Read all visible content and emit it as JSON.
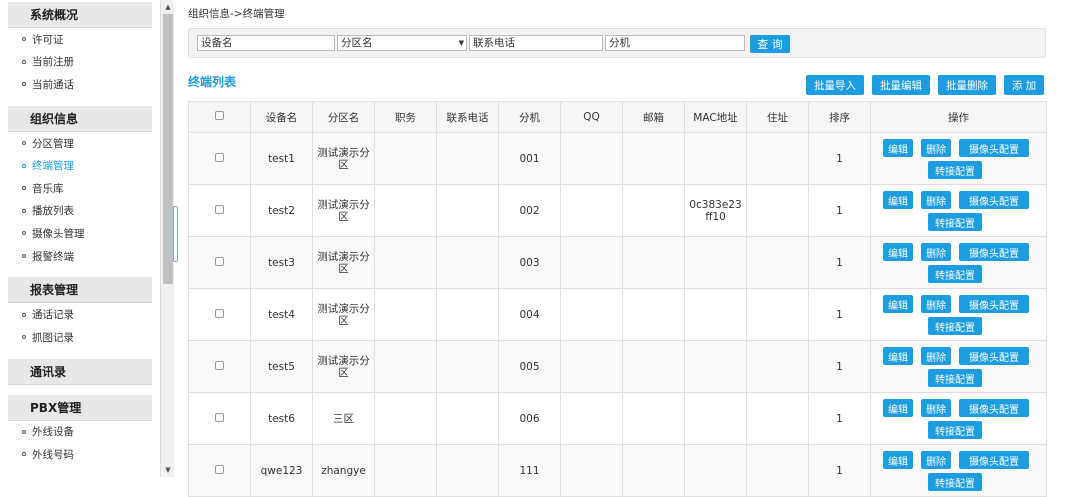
{
  "sidebar": {
    "sections": [
      {
        "title": "系统概况",
        "items": [
          "许可证",
          "当前注册",
          "当前通话"
        ]
      },
      {
        "title": "组织信息",
        "items": [
          "分区管理",
          "终端管理",
          "音乐库",
          "播放列表",
          "摄像头管理",
          "报警终端"
        ]
      },
      {
        "title": "报表管理",
        "items": [
          "通话记录",
          "抓图记录"
        ]
      },
      {
        "title": "通讯录",
        "items": []
      },
      {
        "title": "PBX管理",
        "items": [
          "外线设备",
          "外线号码"
        ]
      }
    ],
    "active_item": "终端管理"
  },
  "breadcrumb": "组织信息->终端管理",
  "search": {
    "device_name": "设备名",
    "zone_select": "分区名",
    "phone": "联系电话",
    "extension": "分机",
    "button": "查 询"
  },
  "list": {
    "title": "终端列表",
    "buttons": {
      "import": "批量导入",
      "edit": "批量编辑",
      "delete": "批量删除",
      "add": "添 加"
    }
  },
  "table": {
    "headers": [
      "",
      "设备名",
      "分区名",
      "职务",
      "联系电话",
      "分机",
      "QQ",
      "邮箱",
      "MAC地址",
      "住址",
      "排序",
      "操作"
    ],
    "ops": {
      "edit": "编辑",
      "delete": "删除",
      "camera": "摄像头配置",
      "transfer": "转接配置"
    },
    "rows": [
      {
        "name": "test1",
        "zone": "测试演示分区",
        "title": "",
        "phone": "",
        "ext": "001",
        "qq": "",
        "email": "",
        "mac": "",
        "addr": "",
        "order": "1"
      },
      {
        "name": "test2",
        "zone": "测试演示分区",
        "title": "",
        "phone": "",
        "ext": "002",
        "qq": "",
        "email": "",
        "mac": "0c383e23ff10",
        "addr": "",
        "order": "1"
      },
      {
        "name": "test3",
        "zone": "测试演示分区",
        "title": "",
        "phone": "",
        "ext": "003",
        "qq": "",
        "email": "",
        "mac": "",
        "addr": "",
        "order": "1"
      },
      {
        "name": "test4",
        "zone": "测试演示分区",
        "title": "",
        "phone": "",
        "ext": "004",
        "qq": "",
        "email": "",
        "mac": "",
        "addr": "",
        "order": "1"
      },
      {
        "name": "test5",
        "zone": "测试演示分区",
        "title": "",
        "phone": "",
        "ext": "005",
        "qq": "",
        "email": "",
        "mac": "",
        "addr": "",
        "order": "1"
      },
      {
        "name": "test6",
        "zone": "三区",
        "title": "",
        "phone": "",
        "ext": "006",
        "qq": "",
        "email": "",
        "mac": "",
        "addr": "",
        "order": "1"
      },
      {
        "name": "qwe123",
        "zone": "zhangye",
        "title": "",
        "phone": "",
        "ext": "111",
        "qq": "",
        "email": "",
        "mac": "",
        "addr": "",
        "order": "1"
      }
    ]
  },
  "colors": {
    "accent": "#1d9ce0",
    "header_bg": "#e8e8e8"
  }
}
